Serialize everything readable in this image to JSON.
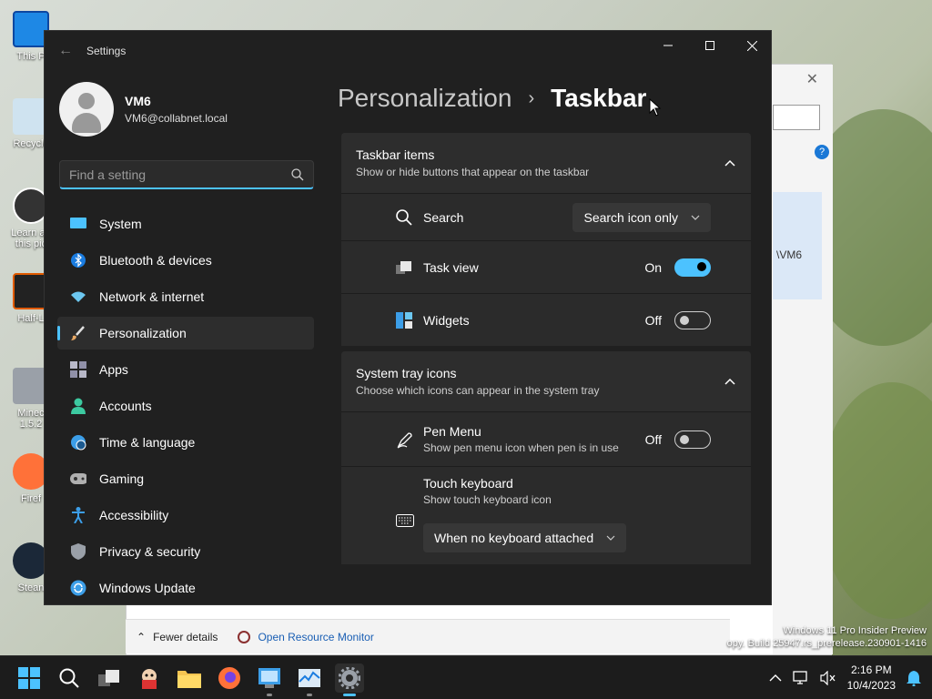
{
  "desktop": {
    "icons": [
      {
        "label": "This P",
        "icon": "monitor-icon"
      },
      {
        "label": "Recycle",
        "icon": "recycle-bin-icon"
      },
      {
        "label": "Learn ab this pic",
        "icon": "camera-icon"
      },
      {
        "label": "Half-L",
        "icon": "half-life-icon"
      },
      {
        "label": "Minec 1.5.2",
        "icon": "minecraft-icon"
      },
      {
        "label": "Firef",
        "icon": "firefox-icon"
      },
      {
        "label": "Stean",
        "icon": "steam-icon"
      }
    ],
    "watermark_line1": "Windows 11 Pro Insider Preview",
    "watermark_line2": "opy. Build 25947.rs_prerelease.230901-1416"
  },
  "background_window": {
    "partial_text": "\\VM6",
    "footer_fewer": "Fewer details",
    "footer_link": "Open Resource Monitor"
  },
  "settings": {
    "app_title": "Settings",
    "user": {
      "name": "VM6",
      "email": "VM6@collabnet.local"
    },
    "search": {
      "placeholder": "Find a setting"
    },
    "nav": [
      {
        "label": "System",
        "icon": "system-icon",
        "color": "#4cc2ff"
      },
      {
        "label": "Bluetooth & devices",
        "icon": "bluetooth-icon",
        "color": "#1a7ce0"
      },
      {
        "label": "Network & internet",
        "icon": "wifi-icon",
        "color": "#6cc7f0"
      },
      {
        "label": "Personalization",
        "icon": "brush-icon",
        "color": "#e8a864",
        "active": true
      },
      {
        "label": "Apps",
        "icon": "apps-icon",
        "color": "#b8b8c8"
      },
      {
        "label": "Accounts",
        "icon": "accounts-icon",
        "color": "#3cc9a0"
      },
      {
        "label": "Time & language",
        "icon": "globe-clock-icon",
        "color": "#3c9ee8"
      },
      {
        "label": "Gaming",
        "icon": "gamepad-icon",
        "color": "#b0b0b0"
      },
      {
        "label": "Accessibility",
        "icon": "accessibility-icon",
        "color": "#3c9ee8"
      },
      {
        "label": "Privacy & security",
        "icon": "shield-icon",
        "color": "#9aa0a8"
      },
      {
        "label": "Windows Update",
        "icon": "update-icon",
        "color": "#3c9ee8"
      }
    ],
    "breadcrumb": {
      "parent": "Personalization",
      "separator": "›",
      "current": "Taskbar"
    },
    "taskbar_items": {
      "title": "Taskbar items",
      "subtitle": "Show or hide buttons that appear on the taskbar",
      "search": {
        "label": "Search",
        "value": "Search icon only"
      },
      "task_view": {
        "label": "Task view",
        "state": "On"
      },
      "widgets": {
        "label": "Widgets",
        "state": "Off"
      }
    },
    "system_tray": {
      "title": "System tray icons",
      "subtitle": "Choose which icons can appear in the system tray",
      "pen_menu": {
        "label": "Pen Menu",
        "sub": "Show pen menu icon when pen is in use",
        "state": "Off"
      },
      "touch_keyboard": {
        "label": "Touch keyboard",
        "sub": "Show touch keyboard icon",
        "value": "When no keyboard attached"
      }
    }
  },
  "taskbar": {
    "time": "2:16 PM",
    "date": "10/4/2023",
    "accent": "#4cc2ff"
  }
}
